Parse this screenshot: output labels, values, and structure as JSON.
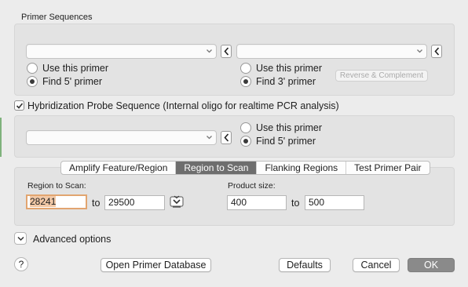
{
  "primer_sequences": {
    "title": "Primer Sequences",
    "forward": {
      "use_label": "Use this primer",
      "find_label": "Find 5' primer",
      "selected": "find"
    },
    "reverse": {
      "use_label": "Use this primer",
      "find_label": "Find 3' primer",
      "selected": "find"
    },
    "reverse_complement_label": "Reverse & Complement"
  },
  "probe": {
    "checkbox_label": "Hybridization Probe Sequence (Internal oligo for realtime PCR analysis)",
    "checked": true,
    "use_label": "Use this primer",
    "find_label": "Find 5' primer",
    "selected": "find"
  },
  "tabs": [
    {
      "label": "Amplify Feature/Region",
      "active": false
    },
    {
      "label": "Region to Scan",
      "active": true
    },
    {
      "label": "Flanking Regions",
      "active": false
    },
    {
      "label": "Test Primer Pair",
      "active": false
    }
  ],
  "region": {
    "label": "Region to Scan:",
    "start": "28241",
    "to_label": "to",
    "end": "29500"
  },
  "product": {
    "label": "Product size:",
    "min": "400",
    "to_label": "to",
    "max": "500"
  },
  "advanced_label": "Advanced options",
  "buttons": {
    "help": "?",
    "open_db": "Open Primer Database",
    "defaults": "Defaults",
    "cancel": "Cancel",
    "ok": "OK"
  },
  "colors": {
    "window_bg": "#ececec",
    "group_bg": "#e3e3e3",
    "active_tab": "#6e6e6e",
    "focus_ring": "#e2a570",
    "selection": "#f2c9a7",
    "ok_button": "#8a8a8a"
  }
}
